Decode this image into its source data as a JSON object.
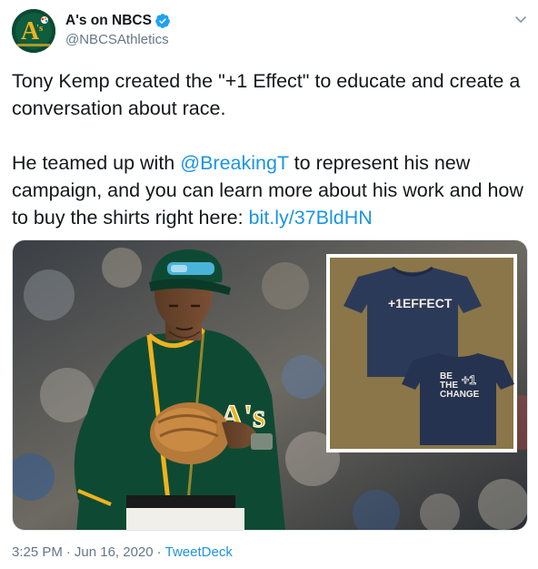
{
  "account": {
    "display_name": "A's on NBCS",
    "handle": "@NBCSAthletics",
    "avatar_icon": "athletics-logo-icon",
    "verified_icon": "verified-badge-icon"
  },
  "tweet": {
    "para1": "Tony Kemp created the \"+1 Effect\" to educate and create a conversation about race.",
    "para2_a": "He teamed up with ",
    "mention": "@BreakingT",
    "para2_b": " to represent his new campaign, and you can learn more about his work and how to buy the shirts right here: ",
    "url": "bit.ly/37BldHN"
  },
  "media": {
    "jersey_text": "A's",
    "shirt_front_text": "+1EFFECT",
    "shirt_back_text": [
      "BE",
      "THE",
      "CHANGE"
    ],
    "shirt_back_mark": "+1"
  },
  "footer": {
    "time": "3:25 PM",
    "date": "Jun 16, 2020",
    "separator": "·",
    "source": "TweetDeck"
  },
  "colors": {
    "link": "#1b95e0",
    "secondary_text": "#657786",
    "team_green": "#0b4a32",
    "team_gold": "#efb21e",
    "shirt_navy": "#2c3a5a",
    "shirt_panel": "#8a7648"
  }
}
